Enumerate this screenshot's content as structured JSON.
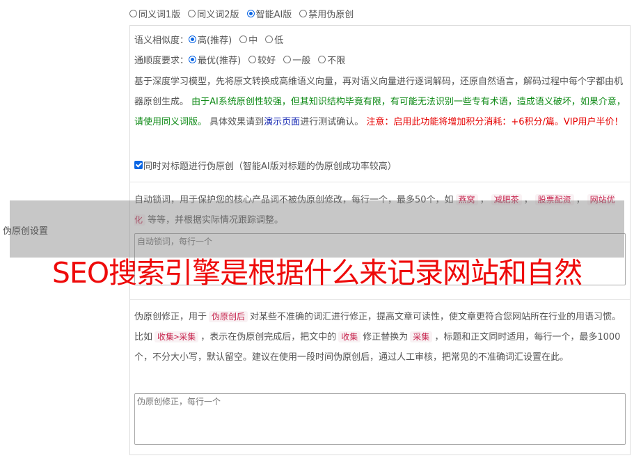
{
  "modes": [
    {
      "label": "同义词1版",
      "selected": false
    },
    {
      "label": "同义词2版",
      "selected": false
    },
    {
      "label": "智能AI版",
      "selected": true
    },
    {
      "label": "禁用伪原创",
      "selected": false
    }
  ],
  "similarity": {
    "label": "语义相似度：",
    "options": [
      {
        "label": "高(推荐)",
        "selected": true
      },
      {
        "label": "中",
        "selected": false
      },
      {
        "label": "低",
        "selected": false
      }
    ]
  },
  "fluency": {
    "label": "通顺度要求：",
    "options": [
      {
        "label": "最优(推荐)",
        "selected": true
      },
      {
        "label": "较好",
        "selected": false
      },
      {
        "label": "一般",
        "selected": false
      },
      {
        "label": "不限",
        "selected": false
      }
    ]
  },
  "description": {
    "part1": "基于深度学习模型，先将原文转换成高维语义向量，再对语义向量进行逐词解码，还原自然语言，解码过程中每个字都由机器原创生成。",
    "part2_green": "由于AI系统原创性较强，但其知识结构毕竟有限，有可能无法识别一些专有术语，造成语义破坏，如果介意，请使用同义词版。",
    "part3": "具体效果请到",
    "demo_link": "演示页面",
    "part4": "进行测试确认。",
    "notice_red": "注意：启用此功能将增加积分消耗：+6积分/篇。VIP用户半价！"
  },
  "title_option": {
    "label": "同时对标题进行伪原创（智能AI版对标题的伪原创成功率较高）",
    "checked": true
  },
  "lock_words": {
    "text1": "自动锁词，用于保护您的核心产品词不被伪原创修改，每行一个，最多50个，如",
    "examples": [
      "燕窝",
      "减肥茶",
      "股票配资",
      "网站优化"
    ],
    "text2": "等等，并根据实际情况跟踪调整。",
    "placeholder": "自动锁词，每行一个"
  },
  "corrections": {
    "text1": "伪原创修正，用于",
    "pill1": "伪原创后",
    "text2": "对某些不准确的词汇进行修正，提高文章可读性，使文章更符合您网站所在行业的用语习惯。比如",
    "pill2": "收集>采集",
    "text3": "，表示在伪原创完成后，把文中的",
    "pill3": "收集",
    "text4": "修正替换为",
    "pill4": "采集",
    "text5": "，标题和正文同时适用，每行一个，最多1000个，不分大小写，默认留空。建议在使用一段时间伪原创后，通过人工审核，把常见的不准确词汇设置在此。",
    "placeholder": "伪原创修正，每行一个"
  },
  "side_label": "伪原创设置",
  "overlay_title": "SEO搜索引擎是根据什么来记录网站和自然"
}
